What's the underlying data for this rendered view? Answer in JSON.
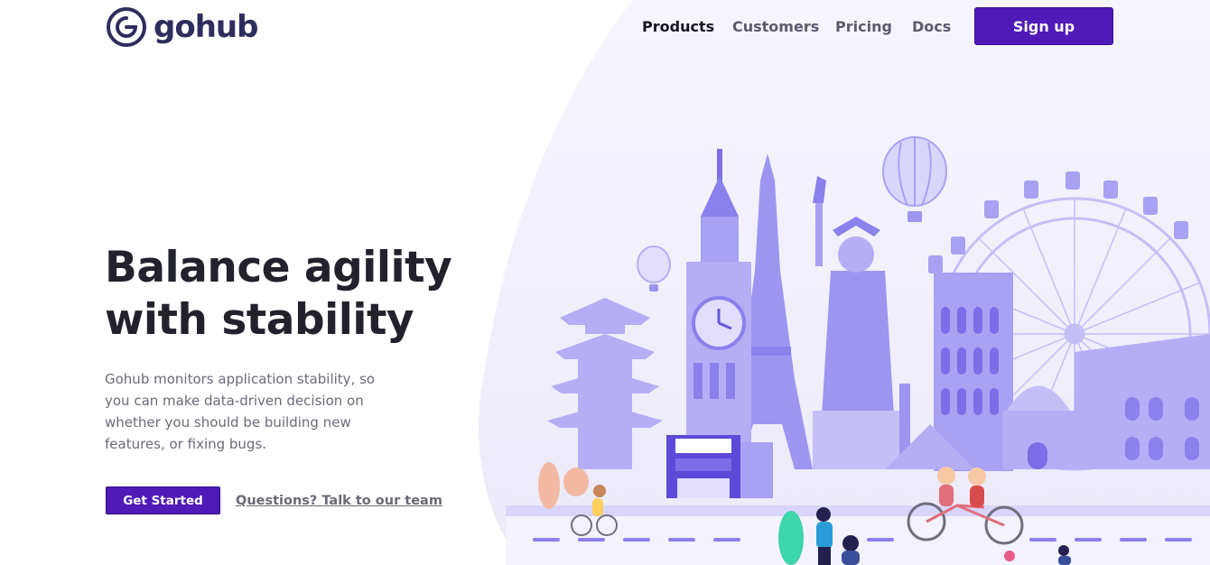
{
  "brand": {
    "name": "gohub",
    "color": "#2f2d5e"
  },
  "nav": {
    "items": [
      {
        "label": "Products",
        "active": true
      },
      {
        "label": "Customers",
        "active": false
      },
      {
        "label": "Pricing",
        "active": false
      },
      {
        "label": "Docs",
        "active": false
      }
    ],
    "signup_label": "Sign up"
  },
  "hero": {
    "headline": "Balance agility with stability",
    "subtext": "Gohub monitors application stability, so you can make data-driven decision on whether you should be building new features, or fixing bugs.",
    "primary_cta": "Get Started",
    "secondary_cta": "Questions? Talk to our team",
    "illustration": "world-landmarks-illustration"
  },
  "colors": {
    "accent": "#4f1ab8",
    "blob": "#efedfb",
    "landmark": "#a9a1f2",
    "landmark_dark": "#7d6ee8"
  }
}
